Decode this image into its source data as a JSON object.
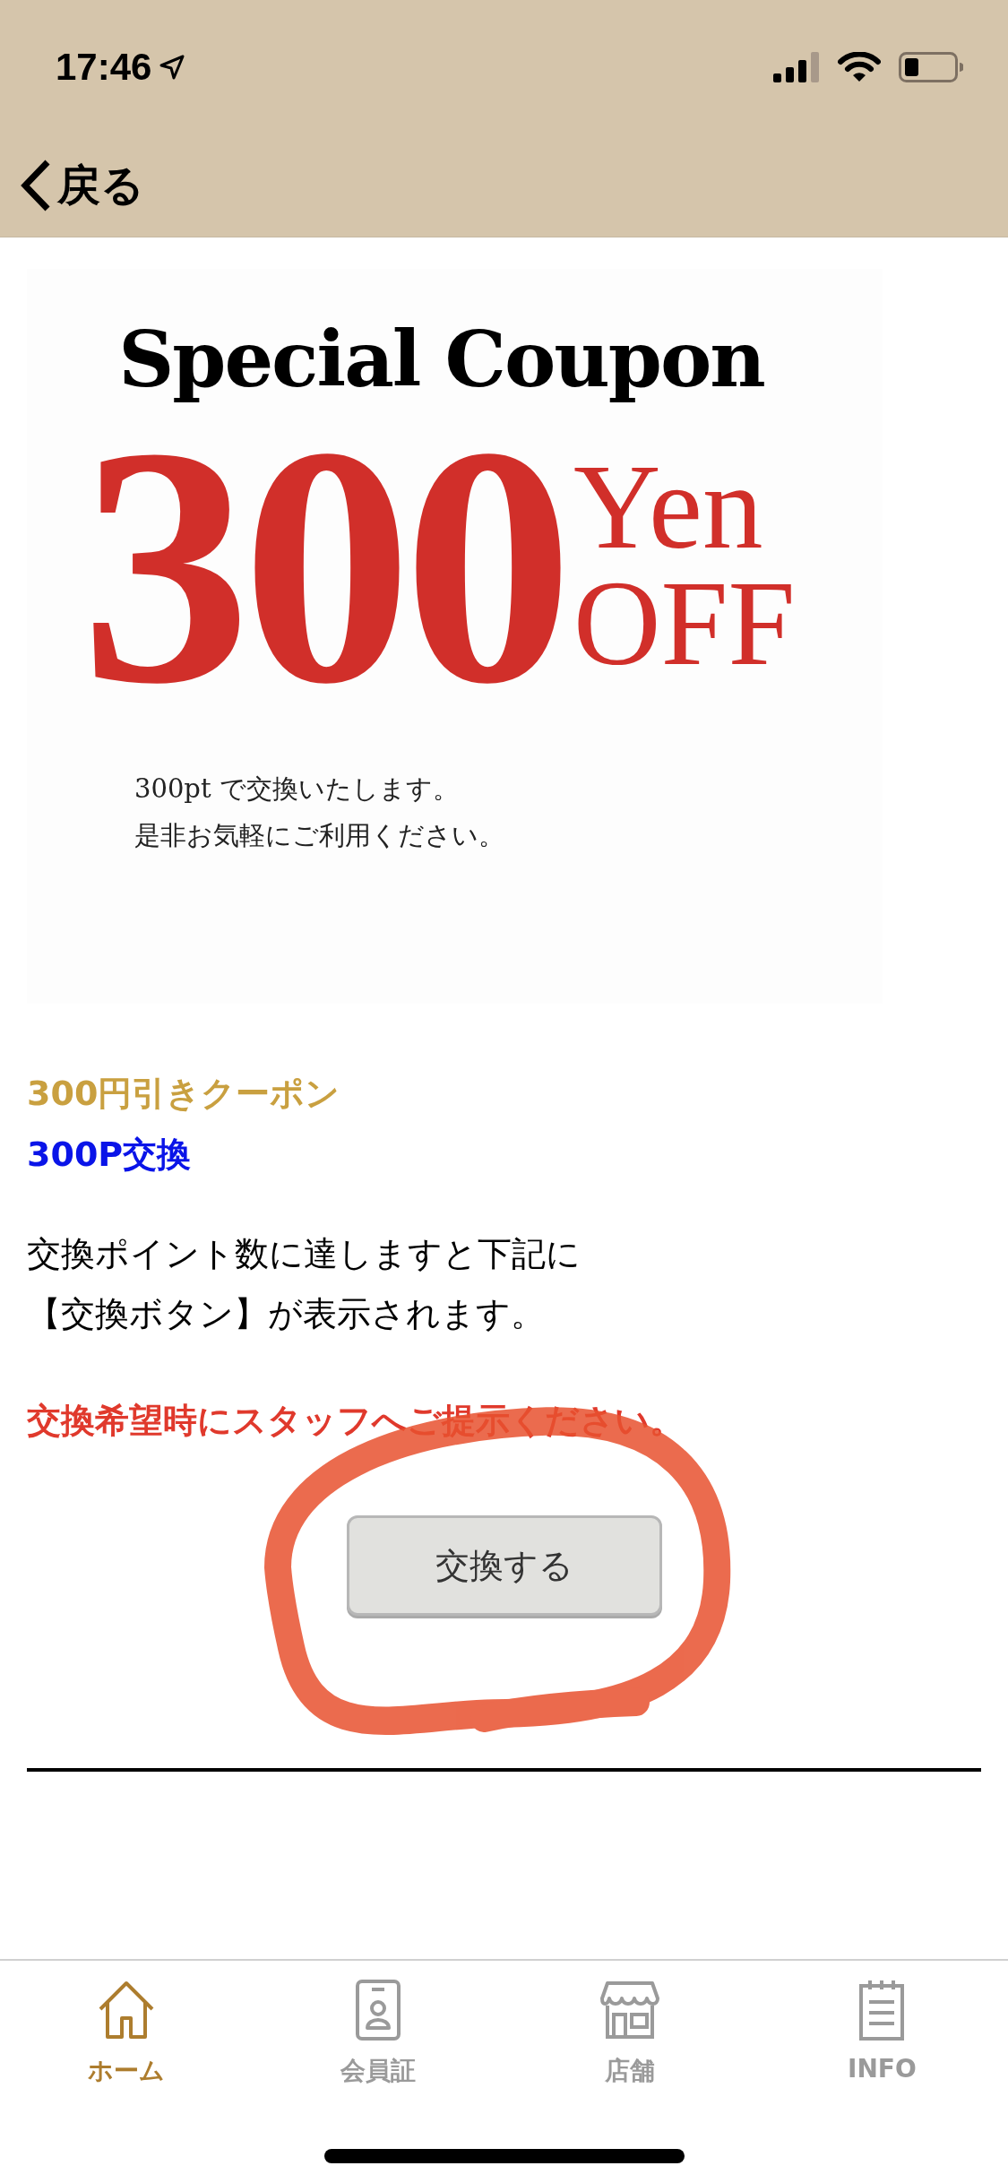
{
  "status_bar": {
    "time": "17:46"
  },
  "nav": {
    "back_label": "戻る"
  },
  "coupon_image": {
    "title": "Special Coupon",
    "amount": "300",
    "unit": "Yen",
    "off": "OFF",
    "lines": [
      "300pt で交換いたします。",
      "是非お気軽にご利用ください。"
    ]
  },
  "coupon_name": "300円引きクーポン",
  "points": "300P交換",
  "description": [
    "交換ポイント数に達しますと下記に",
    "【交換ボタン】が表示されます。"
  ],
  "notice": "交換希望時にスタッフへご提示ください。",
  "exchange_button": {
    "label": "交換する"
  },
  "tabs": [
    {
      "label": "ホーム",
      "kind": "home",
      "selected": true
    },
    {
      "label": "会員証",
      "kind": "card",
      "selected": false
    },
    {
      "label": "店舗",
      "kind": "shop",
      "selected": false
    },
    {
      "label": "INFO",
      "kind": "info",
      "selected": false
    }
  ]
}
